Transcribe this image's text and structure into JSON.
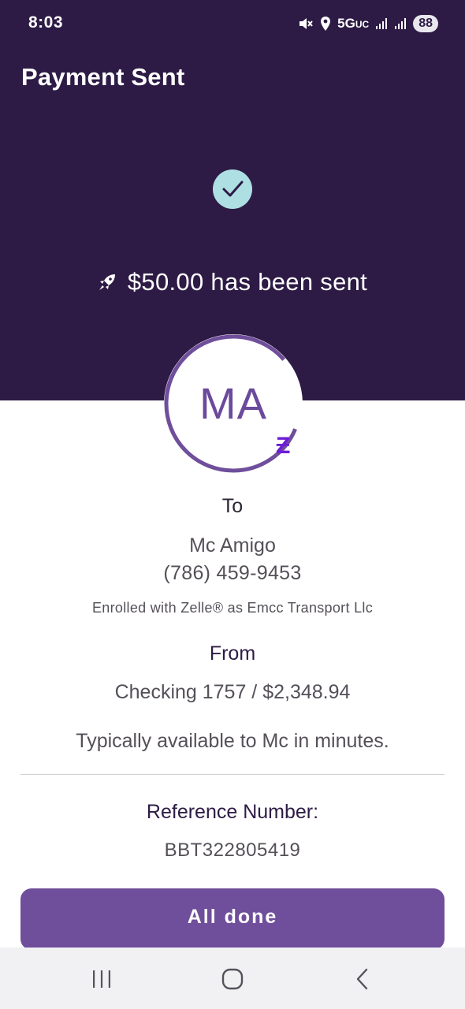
{
  "status_bar": {
    "time": "8:03",
    "network": "5G",
    "network_suffix": "UC",
    "battery": "88",
    "icons": [
      "mute-vibrate-icon",
      "location-icon",
      "signal-icon",
      "signal-icon",
      "battery-icon"
    ]
  },
  "header": {
    "title": "Payment Sent",
    "sent_message": "$50.00 has been sent",
    "icons": [
      "check-icon",
      "rocket-icon"
    ]
  },
  "recipient": {
    "initials": "MA",
    "to_label": "To",
    "name": "Mc Amigo",
    "phone": "(786) 459-9453",
    "enrolled": "Enrolled with Zelle® as Emcc Transport Llc",
    "badge_glyph": "Ƶ"
  },
  "source": {
    "from_label": "From",
    "account": "Checking 1757 / $2,348.94",
    "availability": "Typically available to Mc in minutes."
  },
  "reference": {
    "label": "Reference Number:",
    "number": "BBT322805419"
  },
  "actions": {
    "done_label": "All done"
  },
  "colors": {
    "header_bg": "#2d1b45",
    "accent": "#6f4e9b",
    "check_bg": "#aee0e3",
    "zelle": "#6d1ed4"
  }
}
